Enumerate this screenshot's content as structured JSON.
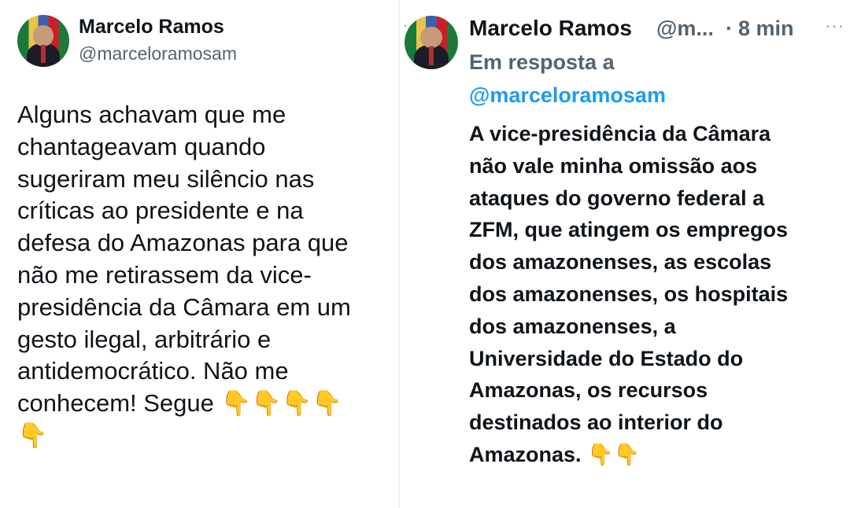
{
  "left_tweet": {
    "author_name": "Marcelo Ramos",
    "author_handle": "@marceloramosam",
    "text": "Alguns achavam que me\nchantageavam quando\nsugeriram meu silêncio nas\ncríticas ao presidente e na\ndefesa do Amazonas para que\nnão me retirassem da vice-\npresidência da Câmara em um\ngesto ilegal, arbitrário e\nantidemocrático. Não me\nconhecem!  Segue 👇👇👇👇\n👇",
    "avatar_icon": "profile-photo"
  },
  "right_tweet": {
    "author_name": "Marcelo Ramos",
    "author_handle_truncated": "@m...",
    "separator": "·",
    "timestamp": "8 min",
    "more_icon": "more-options-icon",
    "reply_label": "Em resposta a",
    "reply_to": "@marceloramosam",
    "text": "A vice-presidência da Câmara\nnão vale minha omissão aos\nataques do governo federal a\nZFM, que atingem os empregos\ndos amazonenses, as escolas\ndos amazonenses, os hospitais\ndos amazonenses, a\nUniversidade do Estado do\nAmazonas, os recursos\ndestinados ao interior do\nAmazonas. 👇👇",
    "avatar_icon": "profile-photo"
  },
  "colors": {
    "text": "#0f1419",
    "secondary": "#536471",
    "link": "#1d9bf0",
    "background": "#ffffff"
  }
}
